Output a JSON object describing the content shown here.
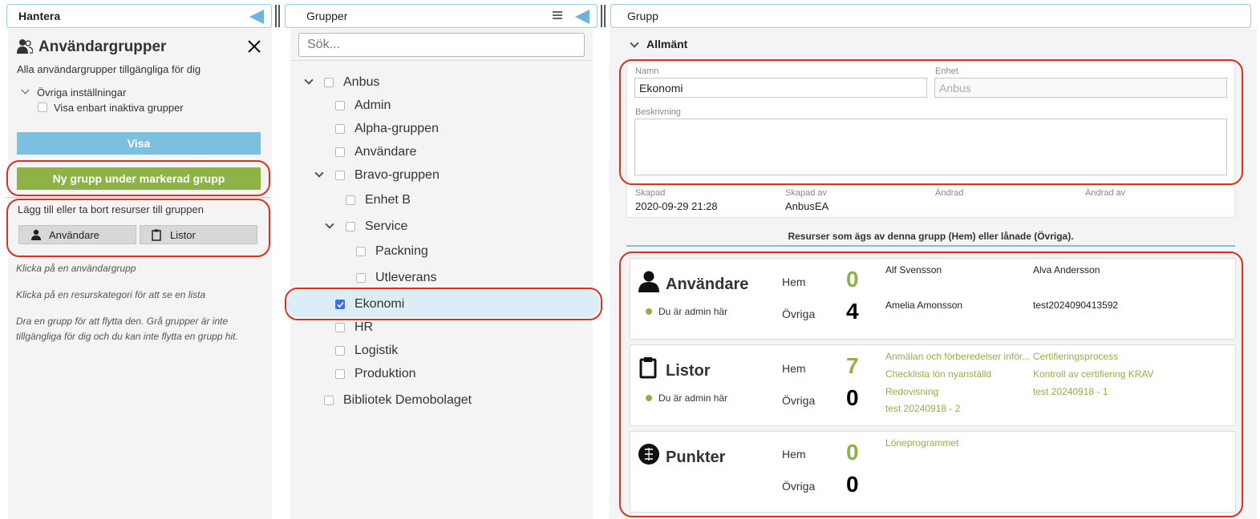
{
  "left_panel": {
    "header_title": "Hantera",
    "title": "Användargrupper",
    "subtitle": "Alla användargrupper tillgängliga för dig",
    "other_settings": "Övriga inställningar",
    "inactive_only": "Visa enbart inaktiva grupper",
    "show_button": "Visa",
    "new_group_button": "Ny grupp under markerad grupp",
    "resources_caption": "Lägg till eller ta bort resurser till gruppen",
    "users_button": "Användare",
    "lists_button": "Listor",
    "hint1": "Klicka på en användargrupp",
    "hint2": "Klicka på en resurskategori för att se en lista",
    "hint3": "Dra en grupp för att flytta den. Grå grupper är inte tillgängliga för dig och du kan inte flytta en grupp hit."
  },
  "middle_panel": {
    "header_title": "Grupper",
    "search_placeholder": "Sök...",
    "tree": [
      {
        "label": "Anbus"
      },
      {
        "label": "Admin"
      },
      {
        "label": "Alpha-gruppen"
      },
      {
        "label": "Användare"
      },
      {
        "label": "Bravo-gruppen"
      },
      {
        "label": "Enhet B"
      },
      {
        "label": "Service"
      },
      {
        "label": "Packning"
      },
      {
        "label": "Utleverans"
      },
      {
        "label": "Ekonomi"
      },
      {
        "label": "HR"
      },
      {
        "label": "Logistik"
      },
      {
        "label": "Produktion"
      },
      {
        "label": "Bibliotek Demobolaget"
      }
    ]
  },
  "right_panel": {
    "header_title": "Grupp",
    "section_title": "Allmänt",
    "name_label": "Namn",
    "name_value": "Ekonomi",
    "unit_label": "Enhet",
    "unit_value": "Anbus",
    "desc_label": "Beskrivning",
    "created_label": "Skapad",
    "created_value": "2020-09-29 21:28",
    "created_by_label": "Skapad av",
    "created_by_value": "AnbusEA",
    "changed_label": "Ändrad",
    "changed_by_label": "Ändrad av",
    "resources_caption": "Resurser som ägs av denna grupp (Hem) eller lånade (Övriga).",
    "home_label": "Hem",
    "other_label": "Övriga",
    "admin_note": "Du är admin här",
    "cards": [
      {
        "title": "Användare",
        "home": "0",
        "other": "4",
        "items": [
          "Alf Svensson",
          "Alva Andersson",
          "Amelia Amonsson",
          "test2024090413592"
        ]
      },
      {
        "title": "Listor",
        "home": "7",
        "other": "0",
        "items": [
          "Anmälan och förberedelser inför...",
          "Certifieringsprocess",
          "Checklista lön nyanställd",
          "Kontroll av certifiering KRAV",
          "Redovisning",
          "test 20240918 - 1",
          "test 20240918 - 2"
        ]
      },
      {
        "title": "Punkter",
        "home": "0",
        "other": "0",
        "items": [
          "Löneprogrammet"
        ]
      }
    ]
  },
  "colors": {
    "accent_blue": "#7cc0e0",
    "green": "#8fb247",
    "red_highlight": "#d7311f",
    "checkbox_blue": "#3b73d9"
  }
}
